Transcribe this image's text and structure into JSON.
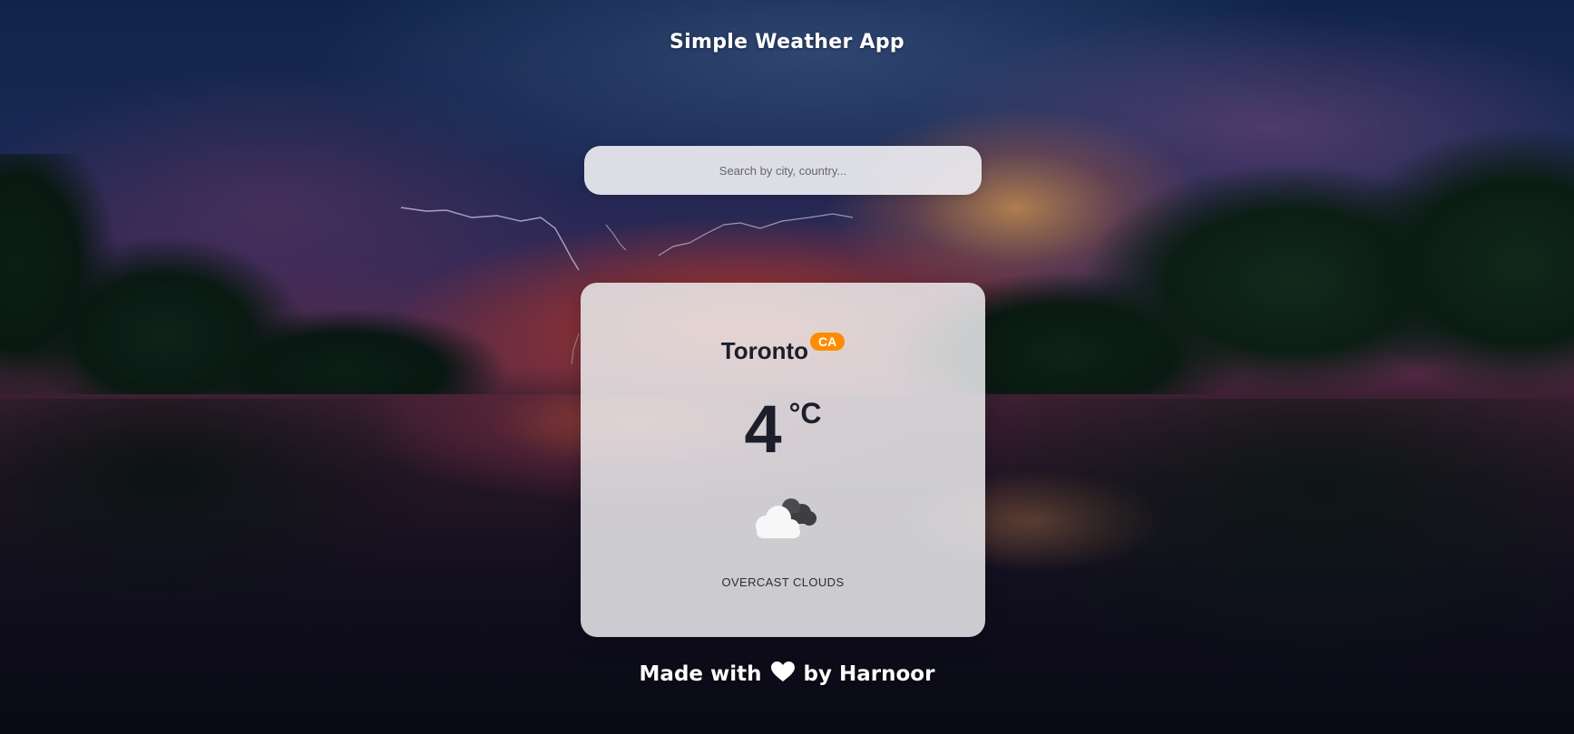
{
  "app": {
    "title": "Simple Weather App"
  },
  "search": {
    "placeholder": "Search by city, country...",
    "value": ""
  },
  "weather": {
    "city": "Toronto",
    "country": "CA",
    "temperature": "4",
    "unit": "°C",
    "condition_icon": "overcast-clouds-icon",
    "description": "OVERCAST CLOUDS"
  },
  "footer": {
    "prefix": "Made with",
    "heart_icon": "heart-icon",
    "suffix": "by Harnoor"
  },
  "colors": {
    "badge": "#ff8c00",
    "card_text": "#1c1f2b",
    "heading_text": "#ffffff"
  }
}
